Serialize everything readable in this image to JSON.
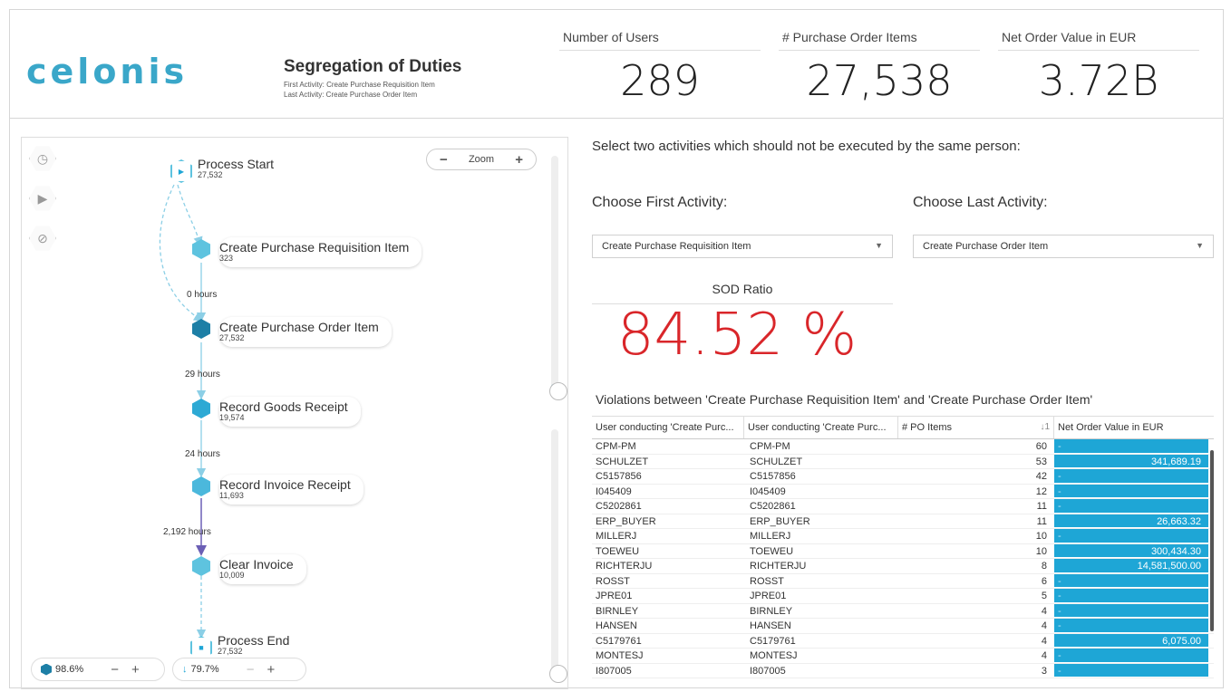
{
  "header": {
    "logo": "celonis",
    "title": "Segregation of Duties",
    "first_activity": "First Activity: Create Purchase Requisition Item",
    "last_activity": "Last Activity: Create Purchase Order Item",
    "kpis": [
      {
        "label": "Number of Users",
        "value": "289"
      },
      {
        "label": "# Purchase Order Items",
        "value": "27,538"
      },
      {
        "label": "Net Order Value in EUR",
        "value": "3.72B"
      }
    ]
  },
  "process": {
    "zoom_label": "Zoom",
    "zoom_minus": "−",
    "zoom_plus": "+",
    "nodes": [
      {
        "name": "Process Start",
        "count": "27,532"
      },
      {
        "name": "Create Purchase Requisition Item",
        "count": "323"
      },
      {
        "name": "Create Purchase Order Item",
        "count": "27,532"
      },
      {
        "name": "Record Goods Receipt",
        "count": "19,574"
      },
      {
        "name": "Record Invoice Receipt",
        "count": "11,693"
      },
      {
        "name": "Clear Invoice",
        "count": "10,009"
      },
      {
        "name": "Process End",
        "count": "27,532"
      }
    ],
    "edges": [
      "0 hours",
      "29 hours",
      "24 hours",
      "2,192 hours"
    ],
    "activity_coverage": "98.6%",
    "connection_coverage": "79.7%",
    "colors": {
      "node_light": "#5ec3df",
      "node_dark": "#1d7fa6",
      "edge": "#8ccfe6",
      "edge_long": "#6b5fb5"
    }
  },
  "selection": {
    "prompt": "Select two activities which should not be executed by the same person:",
    "first_label": "Choose First Activity:",
    "last_label": "Choose Last Activity:",
    "first_value": "Create Purchase Requisition Item",
    "last_value": "Create Purchase Order Item"
  },
  "sod": {
    "label": "SOD Ratio",
    "value": "84.52 %",
    "color": "#d9262a"
  },
  "violations": {
    "title": "Violations between 'Create Purchase Requisition Item' and 'Create Purchase Order Item'",
    "columns": [
      "User conducting 'Create Purc...",
      "User conducting 'Create Purc...",
      "# PO Items",
      "Net Order Value in EUR"
    ],
    "sort_indicator": "↓1",
    "rows": [
      {
        "a": "CPM-PM",
        "b": "CPM-PM",
        "n": "60",
        "v": ""
      },
      {
        "a": "SCHULZET",
        "b": "SCHULZET",
        "n": "53",
        "v": "341,689.19"
      },
      {
        "a": "C5157856",
        "b": "C5157856",
        "n": "42",
        "v": ""
      },
      {
        "a": "I045409",
        "b": "I045409",
        "n": "12",
        "v": ""
      },
      {
        "a": "C5202861",
        "b": "C5202861",
        "n": "11",
        "v": ""
      },
      {
        "a": "ERP_BUYER",
        "b": "ERP_BUYER",
        "n": "11",
        "v": "26,663.32"
      },
      {
        "a": "MILLERJ",
        "b": "MILLERJ",
        "n": "10",
        "v": ""
      },
      {
        "a": "TOEWEU",
        "b": "TOEWEU",
        "n": "10",
        "v": "300,434.30"
      },
      {
        "a": "RICHTERJU",
        "b": "RICHTERJU",
        "n": "8",
        "v": "14,581,500.00"
      },
      {
        "a": "ROSST",
        "b": "ROSST",
        "n": "6",
        "v": ""
      },
      {
        "a": "JPRE01",
        "b": "JPRE01",
        "n": "5",
        "v": ""
      },
      {
        "a": "BIRNLEY",
        "b": "BIRNLEY",
        "n": "4",
        "v": ""
      },
      {
        "a": "HANSEN",
        "b": "HANSEN",
        "n": "4",
        "v": ""
      },
      {
        "a": "C5179761",
        "b": "C5179761",
        "n": "4",
        "v": "6,075.00"
      },
      {
        "a": "MONTESJ",
        "b": "MONTESJ",
        "n": "4",
        "v": ""
      },
      {
        "a": "I807005",
        "b": "I807005",
        "n": "3",
        "v": ""
      }
    ]
  }
}
